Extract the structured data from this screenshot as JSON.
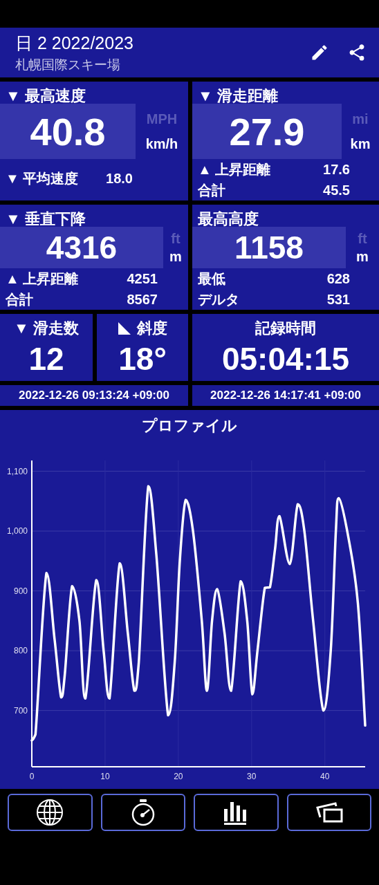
{
  "header": {
    "title": "日 2 2022/2023",
    "subtitle": "札幌国際スキー場"
  },
  "stats": [
    {
      "label": "▼ 最高速度",
      "value": "40.8",
      "units": [
        {
          "label": "MPH",
          "selected": false
        },
        {
          "label": "km/h",
          "selected": true
        }
      ],
      "rows": [
        {
          "label": "▼ 平均速度",
          "value": "18.0"
        }
      ]
    },
    {
      "label": "▼ 滑走距離",
      "value": "27.9",
      "units": [
        {
          "label": "mi",
          "selected": false
        },
        {
          "label": "km",
          "selected": true
        }
      ],
      "rows": [
        {
          "label": "▲ 上昇距離",
          "value": "17.6"
        },
        {
          "label": "合計",
          "value": "45.5"
        }
      ]
    },
    {
      "label": "▼ 垂直下降",
      "value": "4316",
      "units": [
        {
          "label": "ft",
          "selected": false
        },
        {
          "label": "m",
          "selected": true
        }
      ],
      "rows": [
        {
          "label": "▲ 上昇距離",
          "value": "4251"
        },
        {
          "label": "合計",
          "value": "8567"
        }
      ]
    },
    {
      "label": "最高高度",
      "value": "1158",
      "units": [
        {
          "label": "ft",
          "selected": false
        },
        {
          "label": "m",
          "selected": true
        }
      ],
      "rows": [
        {
          "label": "最低",
          "value": "628"
        },
        {
          "label": "デルタ",
          "value": "531"
        }
      ]
    }
  ],
  "runs": {
    "label": "▼ 滑走数",
    "value": "12"
  },
  "slope": {
    "label": "斜度",
    "value": "18°"
  },
  "duration": {
    "label": "記録時間",
    "value": "05:04:15"
  },
  "start_time": "2022-12-26 09:13:24 +09:00",
  "end_time": "2022-12-26 14:17:41 +09:00",
  "profile": {
    "title": "プロファイル",
    "chart_data": {
      "type": "line",
      "x": [
        0,
        0.5,
        2,
        3.1,
        4,
        4.5,
        5.5,
        6.5,
        7.3,
        8.8,
        9.8,
        10.6,
        12,
        13.1,
        14,
        14.6,
        15.9,
        17,
        18.6,
        19.5,
        20.2,
        21,
        22,
        23.2,
        23.9,
        24.6,
        25.3,
        26.3,
        27.2,
        28.5,
        29.4,
        30.1,
        30.8,
        31.8,
        32.5,
        33.2,
        33.8,
        35.2,
        36.3,
        37.2,
        38.4,
        39.8,
        40.8,
        41.5,
        41.9,
        43.2,
        44.5,
        45.5
      ],
      "series": [
        {
          "color": "#ffffff",
          "values": [
            650,
            660,
            930,
            820,
            722,
            760,
            908,
            850,
            720,
            918,
            800,
            720,
            946,
            830,
            733,
            780,
            1075,
            960,
            692,
            780,
            950,
            1052,
            1000,
            850,
            733,
            850,
            903,
            830,
            733,
            916,
            850,
            727,
            800,
            905,
            906,
            970,
            1025,
            945,
            1045,
            1000,
            850,
            700,
            800,
            1000,
            1055,
            990,
            880,
            675
          ]
        }
      ],
      "grid": true,
      "xlim": [
        0,
        45.5
      ],
      "ylim": [
        606,
        1118
      ],
      "xticks": [
        0,
        10,
        20,
        30,
        40
      ],
      "yticks": [
        {
          "value": 700,
          "label": "700"
        },
        {
          "value": 800,
          "label": "800"
        },
        {
          "value": 900,
          "label": "900"
        },
        {
          "value": 1000,
          "label": "1,000"
        },
        {
          "value": 1100,
          "label": "1,100"
        }
      ]
    }
  },
  "nav": [
    {
      "kind": "globe"
    },
    {
      "kind": "stopwatch"
    },
    {
      "kind": "bars"
    },
    {
      "kind": "photos"
    }
  ]
}
